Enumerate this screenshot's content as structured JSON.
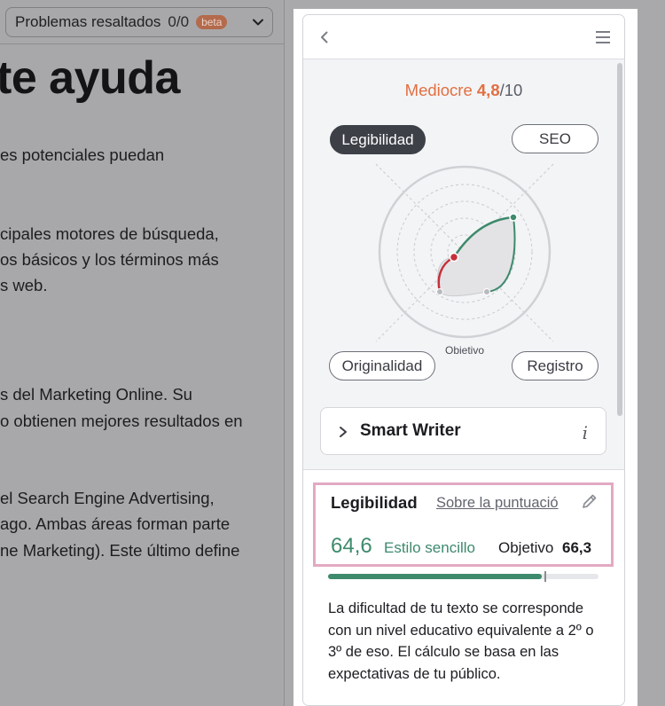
{
  "toolbar": {
    "issues_label": "Problemas resaltados",
    "issues_count": "0/0",
    "beta_badge": "beta"
  },
  "document": {
    "heading": "te ayuda",
    "lines": [
      "es potenciales puedan",
      "cipales motores de búsqueda,",
      "os básicos y los términos más",
      "s web.",
      "s del Marketing Online. Su",
      "o obtienen mejores resultados en",
      "el Search Engine Advertising,",
      "ago. Ambas áreas forman parte",
      "ne Marketing). Este último define"
    ]
  },
  "panel": {
    "score": {
      "label": "Mediocre",
      "value": "4,8",
      "max": "/10"
    },
    "tabs": {
      "legibilidad": "Legibilidad",
      "seo": "SEO",
      "originalidad": "Originalidad",
      "registro": "Registro"
    },
    "radar": {
      "target_label": "Objetivo"
    },
    "smart_writer": {
      "label": "Smart Writer",
      "info": "i"
    },
    "readability": {
      "title": "Legibilidad",
      "link": "Sobre la puntuació",
      "score": "64,6",
      "style": "Estilo sencillo",
      "target_label": "Objetivo",
      "target": "66,3",
      "progress_fraction": 0.79,
      "target_fraction": 0.8,
      "description": "La dificultad de tu texto se corresponde con un nivel educativo equivalente a 2º o 3º de eso. El cálculo se basa en las expectativas de tu público."
    }
  },
  "colors": {
    "score_accent": "#e26f41",
    "good_green": "#3d8a6c",
    "low_red": "#c6303b",
    "highlight_pink": "#e3a9c2"
  }
}
